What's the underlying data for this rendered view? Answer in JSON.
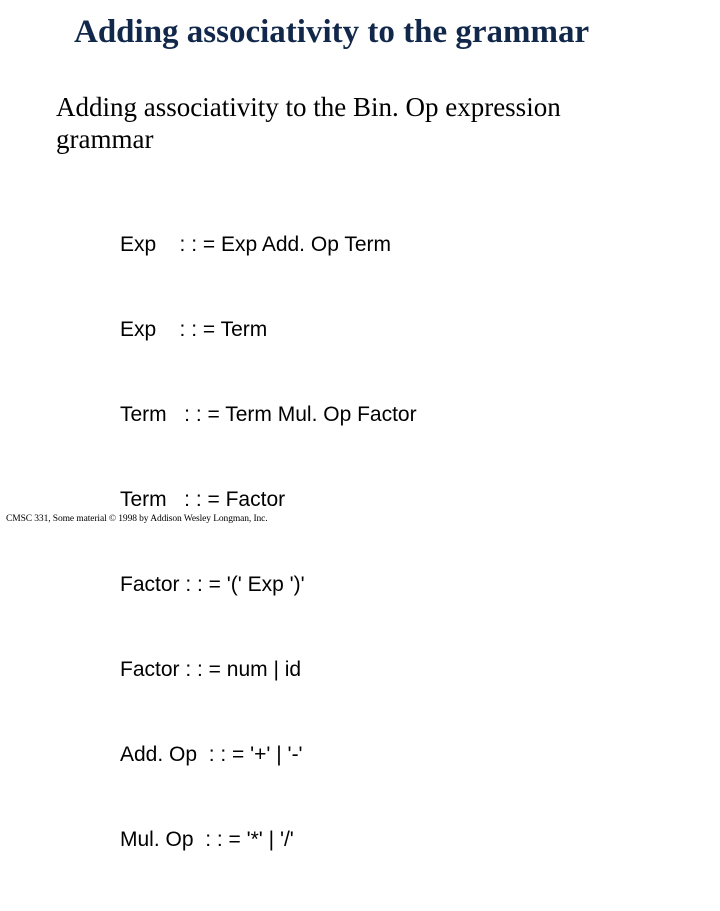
{
  "title": "Adding associativity to the grammar",
  "subtitle": "Adding associativity to the Bin. Op expression grammar",
  "grammar": {
    "lines": [
      "Exp    : : = Exp Add. Op Term",
      "Exp    : : = Term",
      "Term   : : = Term Mul. Op Factor",
      "Term   : : = Factor",
      "Factor : : = '(' Exp ')'",
      "Factor : : = num | id",
      "Add. Op  : : = '+' | '-'",
      "Mul. Op  : : = '*' | '/'"
    ]
  },
  "footer": "CMSC 331, Some material © 1998 by Addison Wesley Longman, Inc."
}
